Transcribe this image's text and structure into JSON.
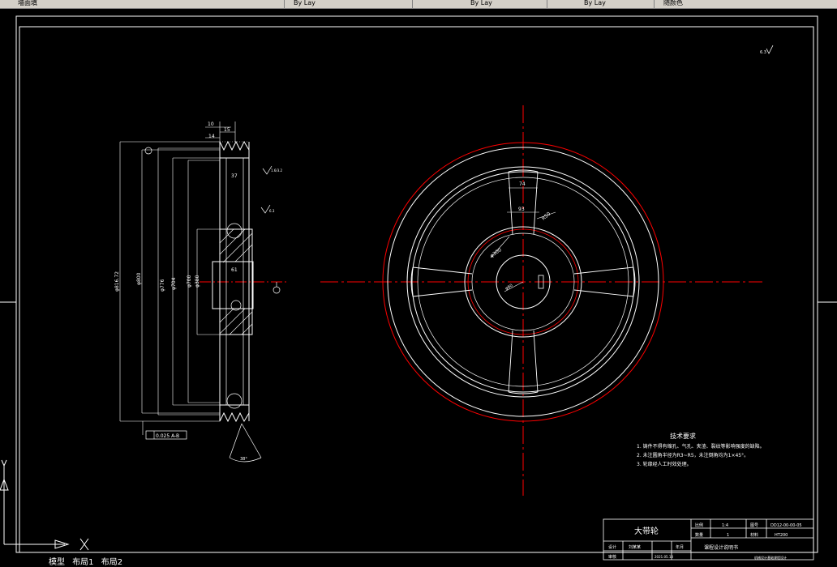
{
  "toolbar": {
    "tab1": "墙面填",
    "tab2": "By Lay",
    "tab3": "By Lay",
    "tab4": "By Lay",
    "tab5": "随颜色"
  },
  "layout_tabs": [
    "模型",
    "布局1",
    "布局2"
  ],
  "side_view": {
    "dim_top1": "10",
    "dim_top2": "15",
    "dim_top3": "14",
    "dim_37": "37",
    "dim_61": "61",
    "dia_outer": "φ816.72",
    "dia_2": "φ800",
    "dia_3": "φ776",
    "dia_4": "φ704",
    "dia_5": "φ700",
    "dia_6": "φ380",
    "roughness1": "1.6/3.2",
    "roughness2": "6.3",
    "tolerance": "0.025 A-B",
    "angle": "38°",
    "datum": "A"
  },
  "front_view": {
    "dim_74": "74",
    "dim_93": "93",
    "dim_r50": "R50",
    "dim_300": "φ300",
    "dim_center": "φ60"
  },
  "tech_req": {
    "title": "技术要求",
    "lines": [
      "1. 铸件不得有缩孔、气孔、夹渣、裂纹等影响强度的缺陷。",
      "2. 未注圆角半径为R3~R5，未注倒角均为1×45°。",
      "3. 轮缘经人工时效处理。"
    ]
  },
  "title_block": {
    "part_name": "大带轮",
    "scale_label": "比例",
    "scale_value": "1:4",
    "drawing_no_label": "图号",
    "drawing_no": "DD12-00-00-05",
    "qty_label": "数量",
    "qty_value": "1",
    "material_label": "材料",
    "material_value": "HT200",
    "design_label": "设计",
    "designer": "刘某某",
    "date_label": "年月",
    "check_label": "审核",
    "school": "课程设计说明书",
    "date": "2021.05.18",
    "footer": "机械设计基础课程设计"
  },
  "corner_mark": "6.3",
  "colors": {
    "accent_red": "#ff0000",
    "line_white": "#ffffff",
    "bg": "#000000"
  }
}
